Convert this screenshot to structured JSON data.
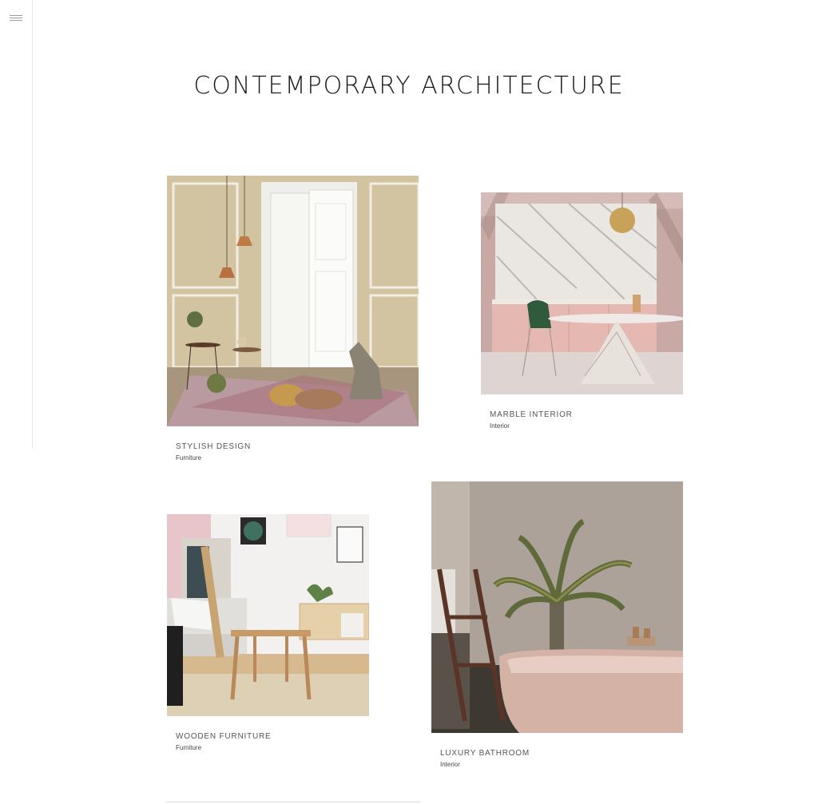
{
  "page": {
    "title": "CONTEMPORARY ARCHITECTURE"
  },
  "menu": {
    "icon": "hamburger-menu-icon"
  },
  "projects": [
    {
      "title": "STYLISH DESIGN",
      "category": "Furniture"
    },
    {
      "title": "MARBLE INTERIOR",
      "category": "Interior"
    },
    {
      "title": "WOODEN FURNITURE",
      "category": "Furniture"
    },
    {
      "title": "LUXURY BATHROOM",
      "category": "Interior"
    }
  ],
  "colors": {
    "text": "#1a1a1a",
    "caption": "#555555",
    "divider": "#e8e8e8"
  }
}
